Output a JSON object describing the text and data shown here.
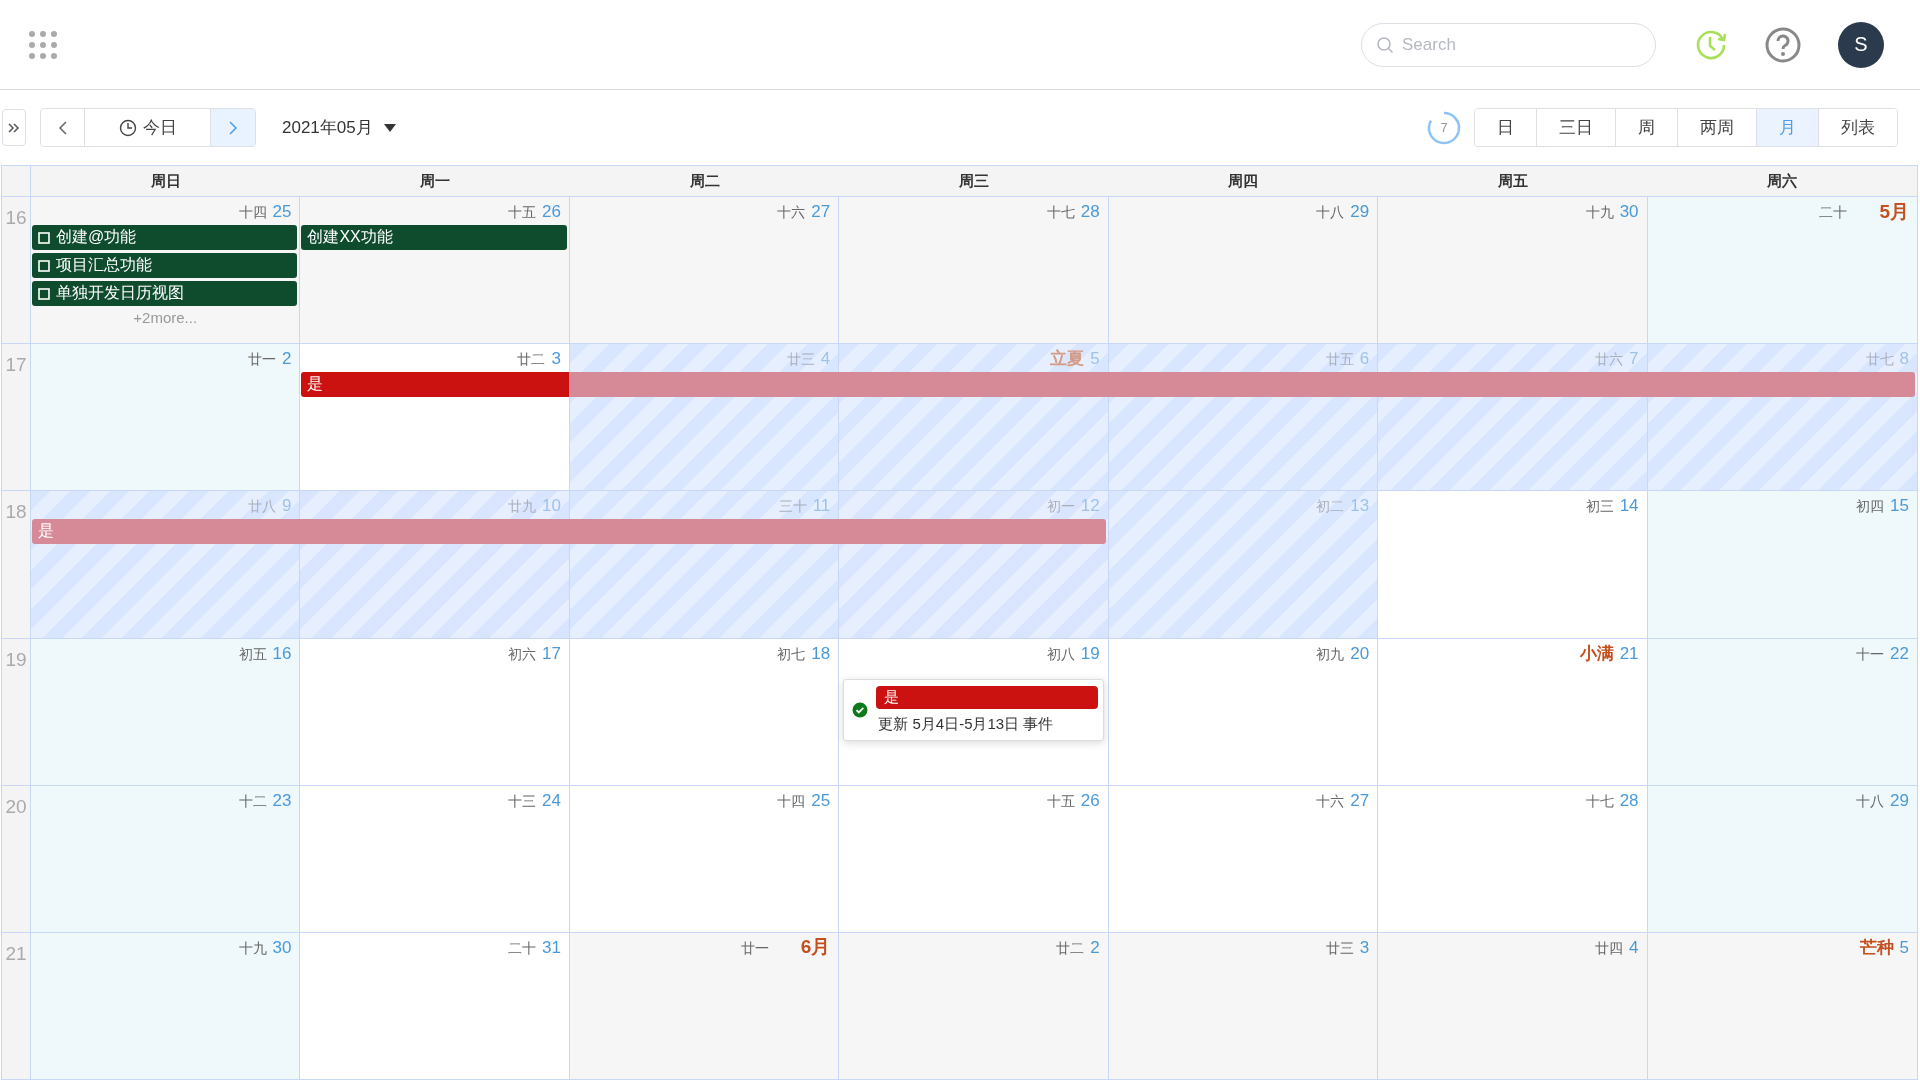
{
  "header": {
    "search": {
      "placeholder": "Search"
    },
    "avatar": "S"
  },
  "toolbar": {
    "today": "今日",
    "month": "2021年05月",
    "counter": {
      "text": "7"
    },
    "views": [
      {
        "label": "日",
        "selected": false
      },
      {
        "label": "三日",
        "selected": false
      },
      {
        "label": "周",
        "selected": false
      },
      {
        "label": "两周",
        "selected": false
      },
      {
        "label": "月",
        "selected": true
      },
      {
        "label": "列表",
        "selected": false
      }
    ]
  },
  "weekdays": [
    "周日",
    "周一",
    "周二",
    "周三",
    "周四",
    "周五",
    "周六"
  ],
  "weeks": [
    {
      "number": "16",
      "days": [
        {
          "lunar": "十四",
          "day": "25",
          "color": "#f6f6f6",
          "hatched": false,
          "events": [
            {
              "title": "创建@功能",
              "kind": "task",
              "checked": false,
              "color": "#0f4c2e"
            },
            {
              "title": "项目汇总功能",
              "kind": "task",
              "checked": false,
              "color": "#0f4c2e"
            },
            {
              "title": "单独开发日历视图",
              "kind": "task",
              "checked": false,
              "color": "#0f4c2e"
            }
          ],
          "more": "+2more..."
        },
        {
          "lunar": "十五",
          "day": "26",
          "color": "#f6f6f6",
          "hatched": false,
          "events": [
            {
              "title": "创建XX功能",
              "kind": "event",
              "color": "#0f4c2e"
            }
          ]
        },
        {
          "lunar": "十六",
          "day": "27",
          "color": "#f6f6f6",
          "hatched": false
        },
        {
          "lunar": "十七",
          "day": "28",
          "color": "#f6f6f6",
          "hatched": false
        },
        {
          "lunar": "十八",
          "day": "29",
          "color": "#f6f6f6",
          "hatched": false
        },
        {
          "lunar": "十九",
          "day": "30",
          "color": "#f6f6f6",
          "hatched": false
        },
        {
          "lunar": "二十",
          "day": "5月",
          "month_start": true,
          "color": "#eff8fb",
          "hatched": false
        }
      ]
    },
    {
      "number": "17",
      "days": [
        {
          "lunar": "廿一",
          "day": "2",
          "color": "#eff8fb",
          "hatched": false
        },
        {
          "lunar": "廿二",
          "day": "3",
          "color": "#ffffff",
          "hatched": false,
          "events": [
            {
              "title": "是",
              "kind": "event",
              "color": "#cc1111"
            }
          ]
        },
        {
          "lunar": "廿三",
          "day": "4",
          "hatched": true,
          "events": [
            {
              "kind": "continued",
              "color": "#d68a98"
            }
          ]
        },
        {
          "lunar": "立夏",
          "solar_term": true,
          "day": "5",
          "hatched": true,
          "events": [
            {
              "kind": "continued",
              "color": "#d68a98"
            }
          ]
        },
        {
          "lunar": "廿五",
          "day": "6",
          "hatched": true,
          "events": [
            {
              "kind": "continued",
              "color": "#d68a98"
            }
          ]
        },
        {
          "lunar": "廿六",
          "day": "7",
          "hatched": true,
          "events": [
            {
              "kind": "continued",
              "color": "#d68a98"
            }
          ]
        },
        {
          "lunar": "廿七",
          "day": "8",
          "hatched": true,
          "events": [
            {
              "kind": "continued",
              "color": "#d68a98"
            }
          ]
        }
      ]
    },
    {
      "number": "18",
      "days": [
        {
          "lunar": "廿八",
          "day": "9",
          "hatched": true,
          "events": [
            {
              "title": "是",
              "kind": "event",
              "color": "#d68a98"
            }
          ]
        },
        {
          "lunar": "廿九",
          "day": "10",
          "hatched": true,
          "events": [
            {
              "kind": "continued",
              "color": "#d68a98"
            }
          ]
        },
        {
          "lunar": "三十",
          "day": "11",
          "hatched": true,
          "events": [
            {
              "kind": "continued",
              "color": "#d68a98"
            }
          ]
        },
        {
          "lunar": "初一",
          "day": "12",
          "hatched": true,
          "events": [
            {
              "kind": "continued",
              "color": "#d68a98"
            }
          ]
        },
        {
          "lunar": "初二",
          "day": "13",
          "hatched": true
        },
        {
          "lunar": "初三",
          "day": "14",
          "color": "#ffffff",
          "hatched": false
        },
        {
          "lunar": "初四",
          "day": "15",
          "color": "#eff8fb",
          "hatched": false
        }
      ]
    },
    {
      "number": "19",
      "days": [
        {
          "lunar": "初五",
          "day": "16",
          "color": "#eff8fb",
          "hatched": false
        },
        {
          "lunar": "初六",
          "day": "17",
          "color": "#ffffff",
          "hatched": false
        },
        {
          "lunar": "初七",
          "day": "18",
          "color": "#ffffff",
          "hatched": false
        },
        {
          "lunar": "初八",
          "day": "19",
          "color": "#ffffff",
          "hatched": false,
          "popup": {
            "title": "是",
            "color": "#cc1111",
            "text": "更新 5月4日-5月13日 事件"
          }
        },
        {
          "lunar": "初九",
          "day": "20",
          "color": "#ffffff",
          "hatched": false
        },
        {
          "lunar": "小满",
          "solar_term": true,
          "day": "21",
          "color": "#ffffff",
          "hatched": false
        },
        {
          "lunar": "十一",
          "day": "22",
          "color": "#eff8fb",
          "hatched": false
        }
      ]
    },
    {
      "number": "20",
      "days": [
        {
          "lunar": "十二",
          "day": "23",
          "color": "#eff8fb",
          "hatched": false
        },
        {
          "lunar": "十三",
          "day": "24",
          "color": "#ffffff",
          "hatched": false
        },
        {
          "lunar": "十四",
          "day": "25",
          "color": "#ffffff",
          "hatched": false
        },
        {
          "lunar": "十五",
          "day": "26",
          "color": "#ffffff",
          "hatched": false
        },
        {
          "lunar": "十六",
          "day": "27",
          "color": "#ffffff",
          "hatched": false
        },
        {
          "lunar": "十七",
          "day": "28",
          "color": "#ffffff",
          "hatched": false
        },
        {
          "lunar": "十八",
          "day": "29",
          "color": "#eff8fb",
          "hatched": false
        }
      ]
    },
    {
      "number": "21",
      "days": [
        {
          "lunar": "十九",
          "day": "30",
          "color": "#eff8fb",
          "hatched": false
        },
        {
          "lunar": "二十",
          "day": "31",
          "color": "#ffffff",
          "hatched": false
        },
        {
          "lunar": "廿一",
          "day": "6月",
          "month_start": true,
          "color": "#f6f6f6",
          "hatched": false
        },
        {
          "lunar": "廿二",
          "day": "2",
          "color": "#f6f6f6",
          "hatched": false
        },
        {
          "lunar": "廿三",
          "day": "3",
          "color": "#f6f6f6",
          "hatched": false
        },
        {
          "lunar": "廿四",
          "day": "4",
          "color": "#f6f6f6",
          "hatched": false
        },
        {
          "lunar": "芒种",
          "solar_term": true,
          "day": "5",
          "color": "#f6f6f6",
          "hatched": false
        }
      ]
    }
  ]
}
